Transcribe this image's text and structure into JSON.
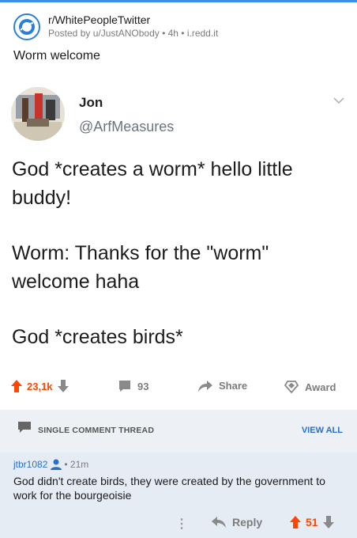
{
  "post": {
    "subreddit": "r/WhitePeopleTwitter",
    "byline": "Posted by u/JustANObody • 4h • i.redd.it",
    "title": "Worm welcome"
  },
  "tweet": {
    "name": "Jon",
    "handle": "@ArfMeasures",
    "paragraphs": [
      "God *creates a worm* hello little buddy!",
      "Worm: Thanks for the \"worm\" welcome haha",
      "God *creates birds*"
    ]
  },
  "actions": {
    "upvotes": "23,1k",
    "comments": "93",
    "share_label": "Share",
    "award_label": "Award"
  },
  "thread": {
    "label": "SINGLE COMMENT THREAD",
    "view_all": "VIEW ALL"
  },
  "comment": {
    "author": "jtbr1082",
    "time": "• 21m",
    "body": "God didn't create birds, they were created by the government to work for the bourgeoisie",
    "reply_label": "Reply",
    "score": "51"
  },
  "colors": {
    "upvote": "#ff4500",
    "link": "#2a6fc9",
    "thread_bg": "#edf1f6",
    "comment_bg": "#e6ecf4"
  },
  "icons": [
    "subreddit-icon",
    "chevron-down-icon",
    "upvote-icon",
    "downvote-icon",
    "comment-icon",
    "share-icon",
    "award-icon",
    "more-icon",
    "reply-icon",
    "user-icon"
  ]
}
